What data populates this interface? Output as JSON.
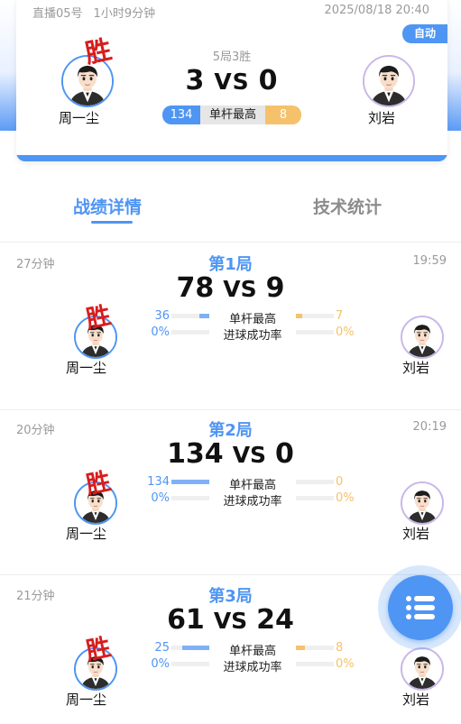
{
  "header": {
    "room": "直播05号",
    "duration": "1小时9分钟",
    "datetime": "2025/08/18 20:40",
    "auto_badge": "自动",
    "format": "5局3胜",
    "score_left": "3",
    "vs": "VS",
    "score_right": "0",
    "highest_break_left": "134",
    "highest_break_label": "单杆最高",
    "highest_break_right": "8",
    "player_left": "周一尘",
    "player_right": "刘岩",
    "win_stamp": "胜"
  },
  "tabs": [
    {
      "label": "战绩详情",
      "active": true
    },
    {
      "label": "技术统计",
      "active": false
    }
  ],
  "games": [
    {
      "duration": "27分钟",
      "title": "第1局",
      "time": "19:59",
      "score_left": "78",
      "vs": "VS",
      "score_right": "9",
      "win_stamp": "胜",
      "winner": "left",
      "player_left": "周一尘",
      "player_right": "刘岩",
      "stats": [
        {
          "label": "单杆最高",
          "left": "36",
          "right": "7",
          "left_fraction": 0.27,
          "right_fraction": 0.16
        },
        {
          "label": "进球成功率",
          "left": "0%",
          "right": "0%",
          "left_fraction": 0,
          "right_fraction": 0
        }
      ]
    },
    {
      "duration": "20分钟",
      "title": "第2局",
      "time": "20:19",
      "score_left": "134",
      "vs": "VS",
      "score_right": "0",
      "win_stamp": "胜",
      "winner": "left",
      "player_left": "周一尘",
      "player_right": "刘岩",
      "stats": [
        {
          "label": "单杆最高",
          "left": "134",
          "right": "0",
          "left_fraction": 1.0,
          "right_fraction": 0
        },
        {
          "label": "进球成功率",
          "left": "0%",
          "right": "0%",
          "left_fraction": 0,
          "right_fraction": 0
        }
      ]
    },
    {
      "duration": "21分钟",
      "title": "第3局",
      "time": "",
      "score_left": "61",
      "vs": "VS",
      "score_right": "24",
      "win_stamp": "胜",
      "winner": "left",
      "player_left": "周一尘",
      "player_right": "刘岩",
      "stats": [
        {
          "label": "单杆最高",
          "left": "25",
          "right": "8",
          "left_fraction": 0.71,
          "right_fraction": 0.23
        },
        {
          "label": "进球成功率",
          "left": "0%",
          "right": "0%",
          "left_fraction": 0,
          "right_fraction": 0
        }
      ]
    }
  ],
  "colors": {
    "accent_blue": "#4f95f3",
    "accent_gold": "#f5c26b",
    "win_red": "#d91c1c"
  },
  "icons": {
    "fab": "list-menu-icon",
    "avatar": "player-avatar-icon"
  }
}
